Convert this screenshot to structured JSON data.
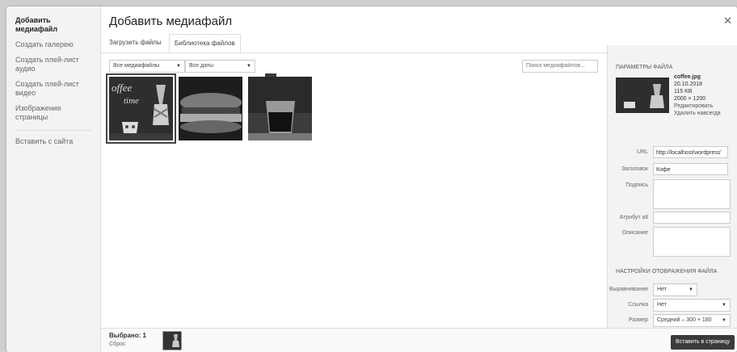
{
  "sidebar": {
    "items": [
      {
        "label": "Добавить медиафайл"
      },
      {
        "label": "Создать галерею"
      },
      {
        "label": "Создать плей-лист аудио"
      },
      {
        "label": "Создать плей-лист видео"
      },
      {
        "label": "Изображение страницы"
      }
    ],
    "secondary": [
      {
        "label": "Вставить с сайта"
      }
    ]
  },
  "header": {
    "title": "Добавить медиафайл",
    "close_icon": "close-icon"
  },
  "tabs": [
    {
      "label": "Загрузить файлы"
    },
    {
      "label": "Библиотека файлов"
    }
  ],
  "filters": {
    "type": "Все медиафайлы",
    "date": "Все даты",
    "search_placeholder": "Поиск медиафайлов..."
  },
  "details": {
    "heading": "ПАРАМЕТРЫ ФАЙЛА",
    "file": {
      "name": "coffee.jpg",
      "date": "20.10.2018",
      "size": "115 KB",
      "dims": "2000 × 1200",
      "edit": "Редактировать",
      "delete": "Удалить навсегда"
    },
    "fields": {
      "url_label": "URL",
      "url_value": "http://localhost/wordpress'",
      "title_label": "Заголовок",
      "title_value": "Кофе",
      "caption_label": "Подпись",
      "alt_label": "Атрибут alt",
      "desc_label": "Описание"
    },
    "display_heading": "НАСТРОЙКИ ОТОБРАЖЕНИЯ ФАЙЛА",
    "display": {
      "align_label": "Выравнивание",
      "align_value": "Нет",
      "link_label": "Ссылка",
      "link_value": "Нет",
      "size_label": "Размер",
      "size_value": "Средний – 300 × 180"
    }
  },
  "footer": {
    "selected": "Выбрано: 1",
    "reset": "Сброс",
    "insert_button": "Вставить в страницу"
  }
}
